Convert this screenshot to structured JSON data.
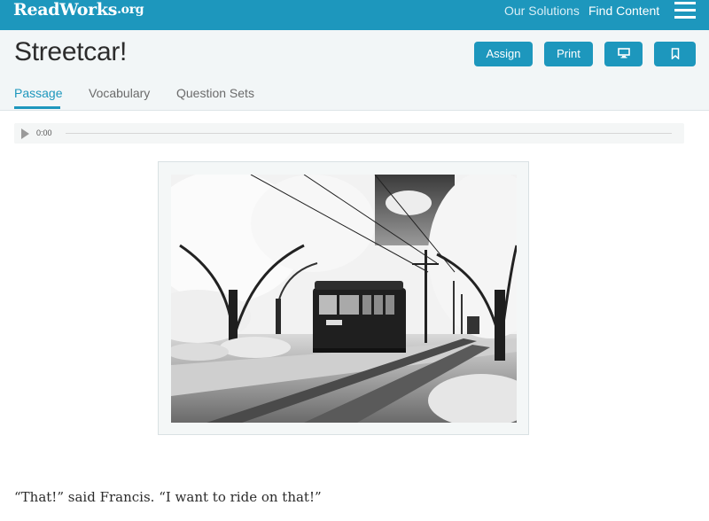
{
  "header": {
    "logo_text": "ReadWorks",
    "logo_suffix": ".org",
    "nav": {
      "solutions": "Our Solutions",
      "find_content": "Find Content"
    },
    "brand_color": "#1d97bd"
  },
  "page": {
    "title": "Streetcar!",
    "buttons": {
      "assign": "Assign",
      "print": "Print",
      "present_icon": "monitor-icon",
      "bookmark_icon": "bookmark-icon"
    },
    "tabs": [
      {
        "label": "Passage",
        "active": true
      },
      {
        "label": "Vocabulary",
        "active": false
      },
      {
        "label": "Question Sets",
        "active": false
      }
    ]
  },
  "audio": {
    "time": "0:00",
    "progress": 0
  },
  "passage": {
    "first_line": "“That!” said Francis. “I want to ride on that!”"
  }
}
